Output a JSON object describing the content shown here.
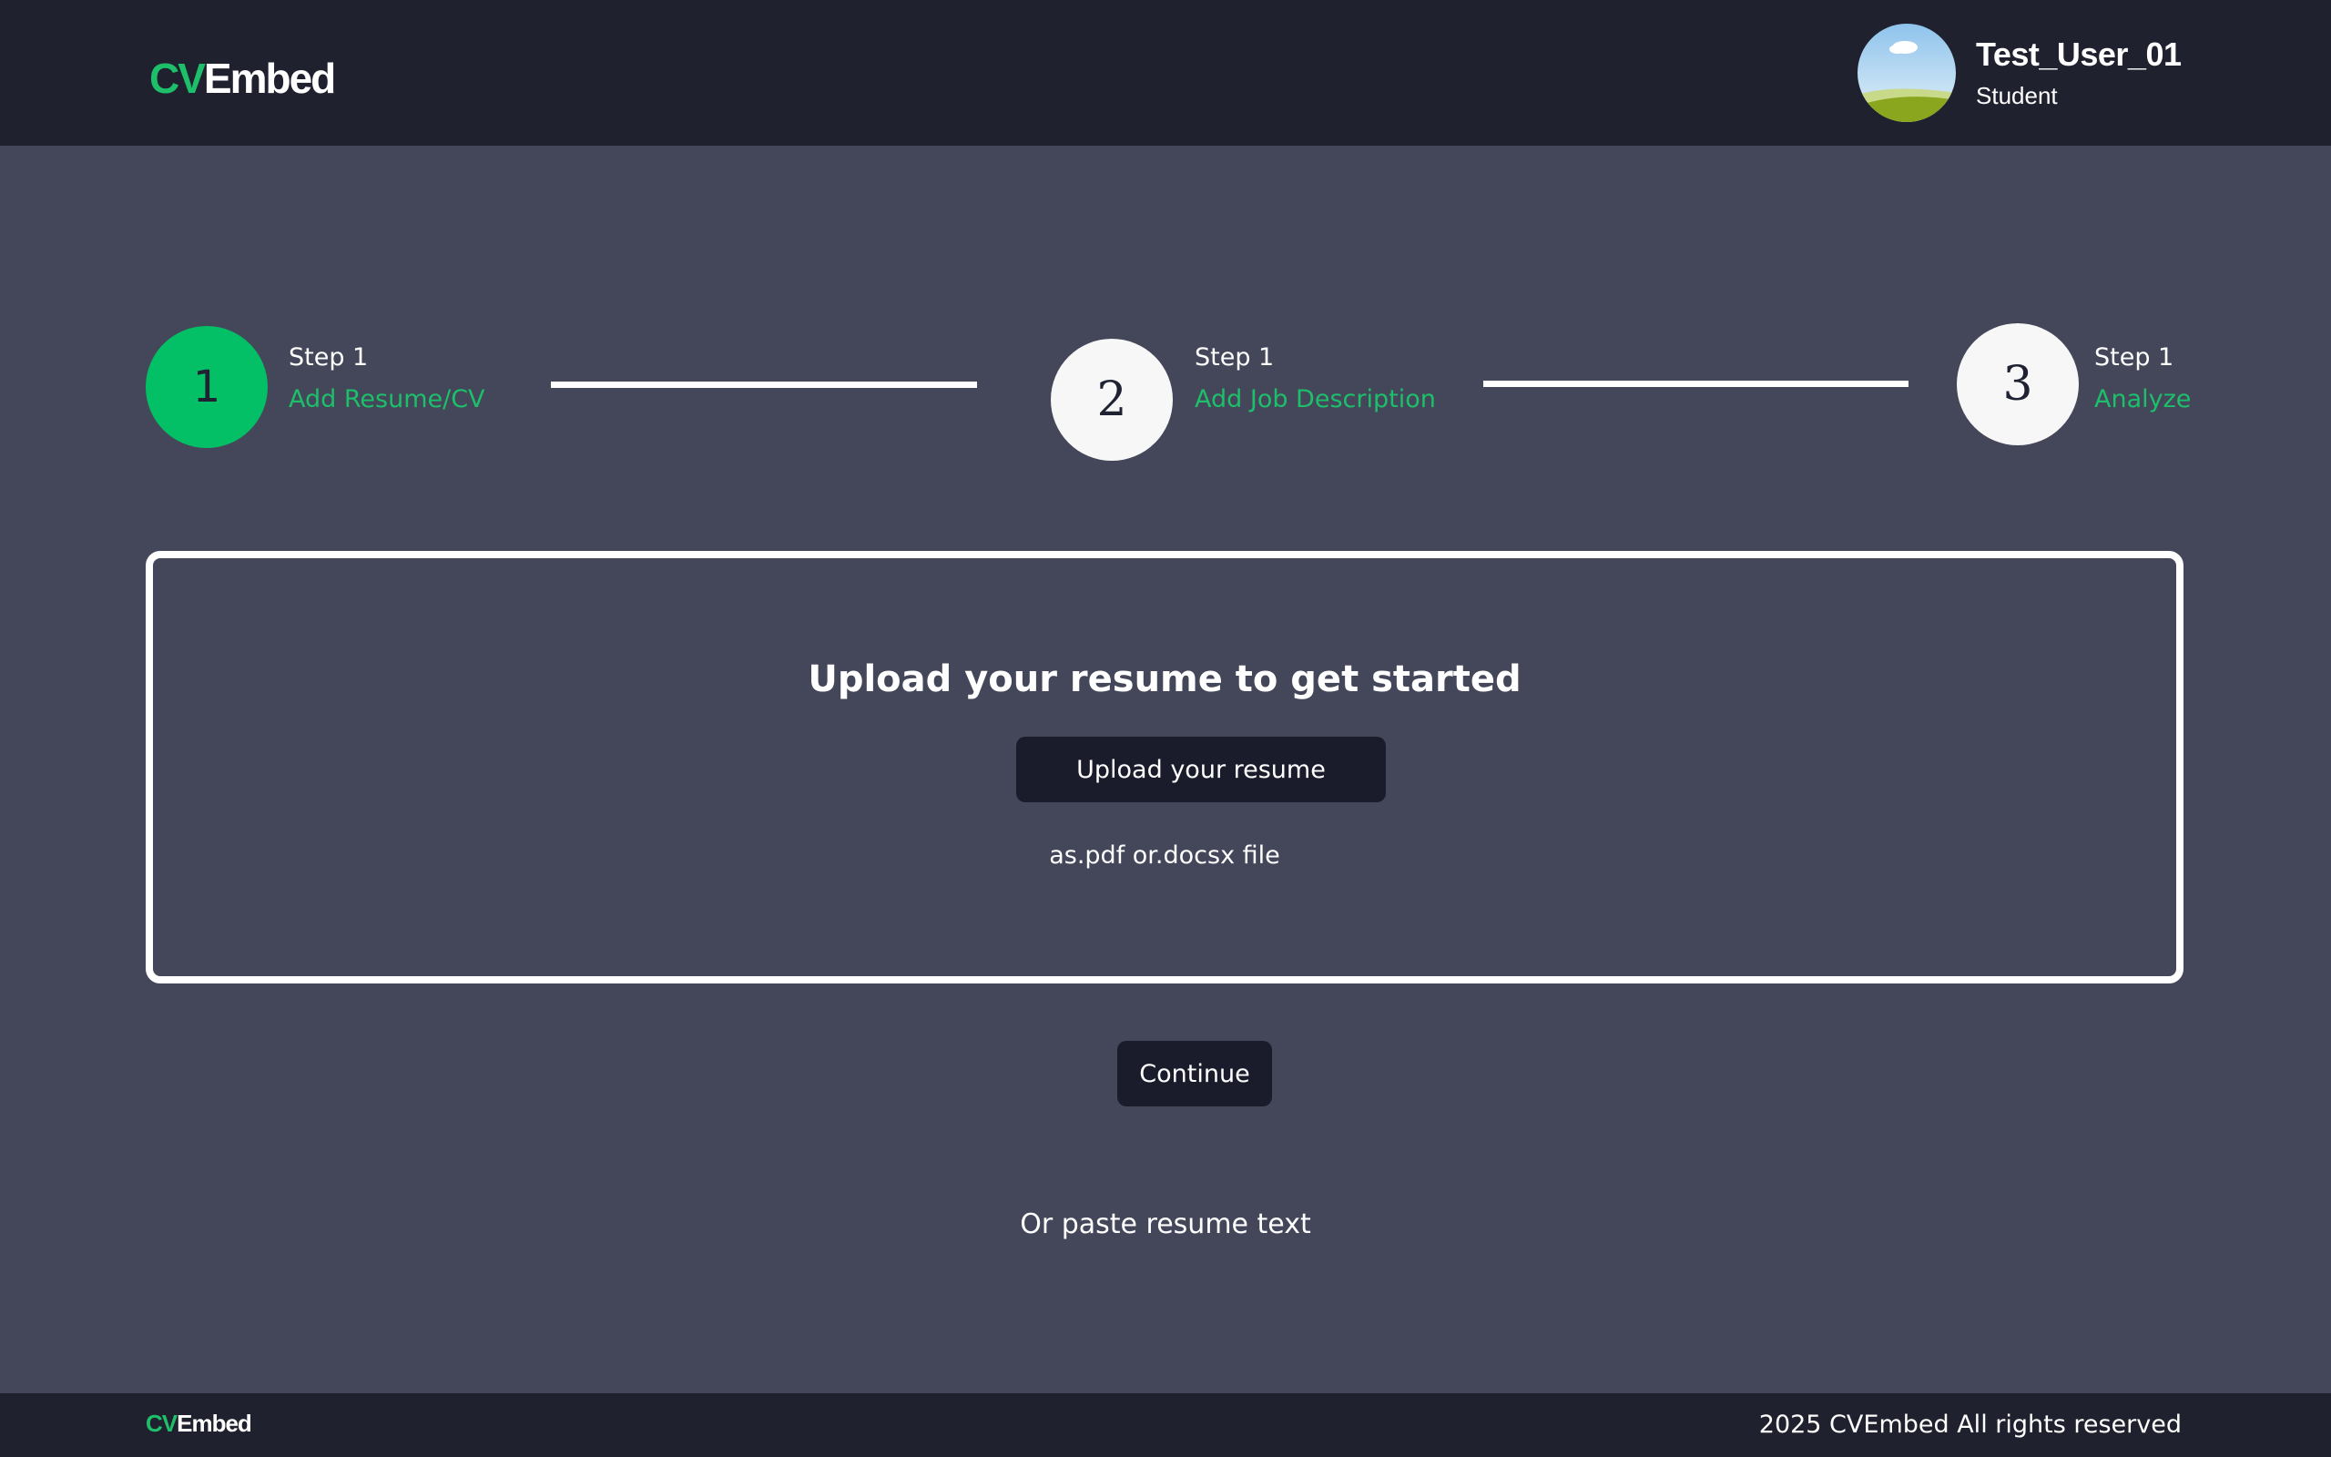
{
  "brand": {
    "cv": "CV",
    "rest": "Embed"
  },
  "user": {
    "name": "Test_User_01",
    "role": "Student"
  },
  "steps": [
    {
      "number": "1",
      "title": "Step 1",
      "label": "Add Resume/CV",
      "active": true
    },
    {
      "number": "2",
      "title": "Step 1",
      "label": "Add Job Description",
      "active": false
    },
    {
      "number": "3",
      "title": "Step 1",
      "label": "Analyze",
      "active": false
    }
  ],
  "upload": {
    "heading": "Upload your resume to get started",
    "button_label": "Upload your resume",
    "hint": "as.pdf or.docsx file"
  },
  "continue_label": "Continue",
  "paste_label": "Or paste resume text",
  "footer": {
    "brand_cv": "CV",
    "brand_rest": "Embed",
    "copyright": "2025 CVEmbed All rights reserved"
  },
  "colors": {
    "accent": "#1dbf6a",
    "header_bg": "#20212e",
    "page_bg": "#44475a",
    "button_bg": "#1b1c2b"
  }
}
